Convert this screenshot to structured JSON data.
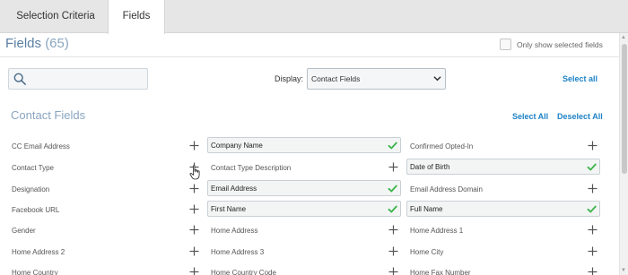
{
  "tabs": [
    {
      "label": "Selection Criteria",
      "active": false
    },
    {
      "label": "Fields",
      "active": true
    }
  ],
  "header": {
    "title": "Fields",
    "count": "(65)",
    "only_selected_label": "Only show selected fields",
    "only_selected_checked": false
  },
  "toolbar": {
    "search_value": "",
    "display_label": "Display:",
    "display_value": "Contact Fields",
    "select_all_label": "Select all"
  },
  "section": {
    "title": "Contact Fields",
    "select_all": "Select All",
    "deselect_all": "Deselect All"
  },
  "fields": [
    [
      {
        "label": "CC Email Address",
        "selected": false
      },
      {
        "label": "Contact Type",
        "selected": false
      },
      {
        "label": "Designation",
        "selected": false
      },
      {
        "label": "Facebook URL",
        "selected": false
      },
      {
        "label": "Gender",
        "selected": false
      },
      {
        "label": "Home Address 2",
        "selected": false
      },
      {
        "label": "Home Country",
        "selected": false
      }
    ],
    [
      {
        "label": "Company Name",
        "selected": true
      },
      {
        "label": "Contact Type Description",
        "selected": false
      },
      {
        "label": "Email Address",
        "selected": true
      },
      {
        "label": "First Name",
        "selected": true
      },
      {
        "label": "Home Address",
        "selected": false
      },
      {
        "label": "Home Address 3",
        "selected": false
      },
      {
        "label": "Home Country Code",
        "selected": false
      }
    ],
    [
      {
        "label": "Confirmed Opted-In",
        "selected": false
      },
      {
        "label": "Date of Birth",
        "selected": true
      },
      {
        "label": "Email Address Domain",
        "selected": false
      },
      {
        "label": "Full Name",
        "selected": true
      },
      {
        "label": "Home Address 1",
        "selected": false
      },
      {
        "label": "Home City",
        "selected": false
      },
      {
        "label": "Home Fax Number",
        "selected": false
      }
    ]
  ],
  "colors": {
    "accent": "#1d82c6",
    "title": "#5b7fa3",
    "check": "#3cb44a",
    "plus": "#555555"
  },
  "icons": {
    "search": "search-icon",
    "plus": "plus-icon",
    "check": "check-icon",
    "chevron": "chevron-down-icon",
    "cursor": "hand-cursor-icon"
  }
}
